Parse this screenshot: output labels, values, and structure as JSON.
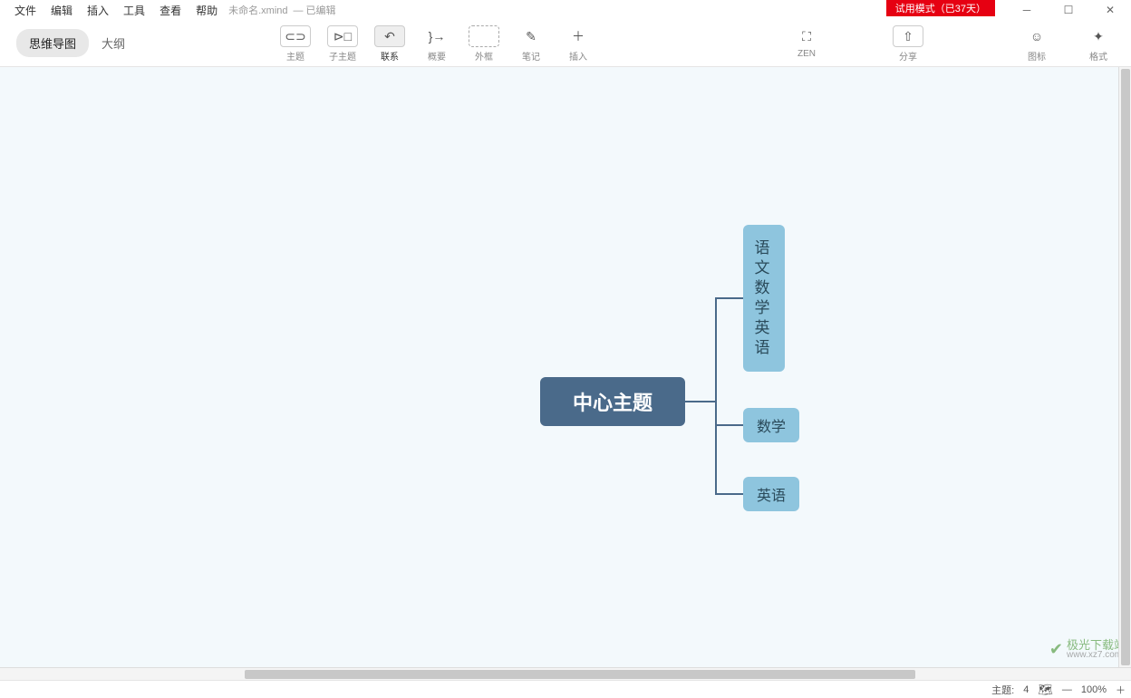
{
  "menu": [
    "文件",
    "编辑",
    "插入",
    "工具",
    "查看",
    "帮助"
  ],
  "filename": "未命名.xmind",
  "edit_status": "— 已编辑",
  "trial": "试用模式（已37天）",
  "view_tabs": {
    "mindmap": "思维导图",
    "outline": "大纲"
  },
  "tools": {
    "topic": "主题",
    "subtopic": "子主题",
    "relation": "联系",
    "summary": "概要",
    "boundary": "外框",
    "note": "笔记",
    "insert": "插入",
    "zen": "ZEN",
    "share": "分享",
    "icons": "图标",
    "format": "格式"
  },
  "nodes": {
    "central": "中心主题",
    "sub1_lines": [
      "语",
      "文",
      "数",
      "学",
      "英",
      "语"
    ],
    "sub2": "数学",
    "sub3": "英语"
  },
  "status": {
    "topic_count_label": "主题:",
    "topic_count": "4",
    "zoom": "100%"
  },
  "watermark": {
    "name": "极光下载站",
    "url": "www.xz7.com"
  }
}
